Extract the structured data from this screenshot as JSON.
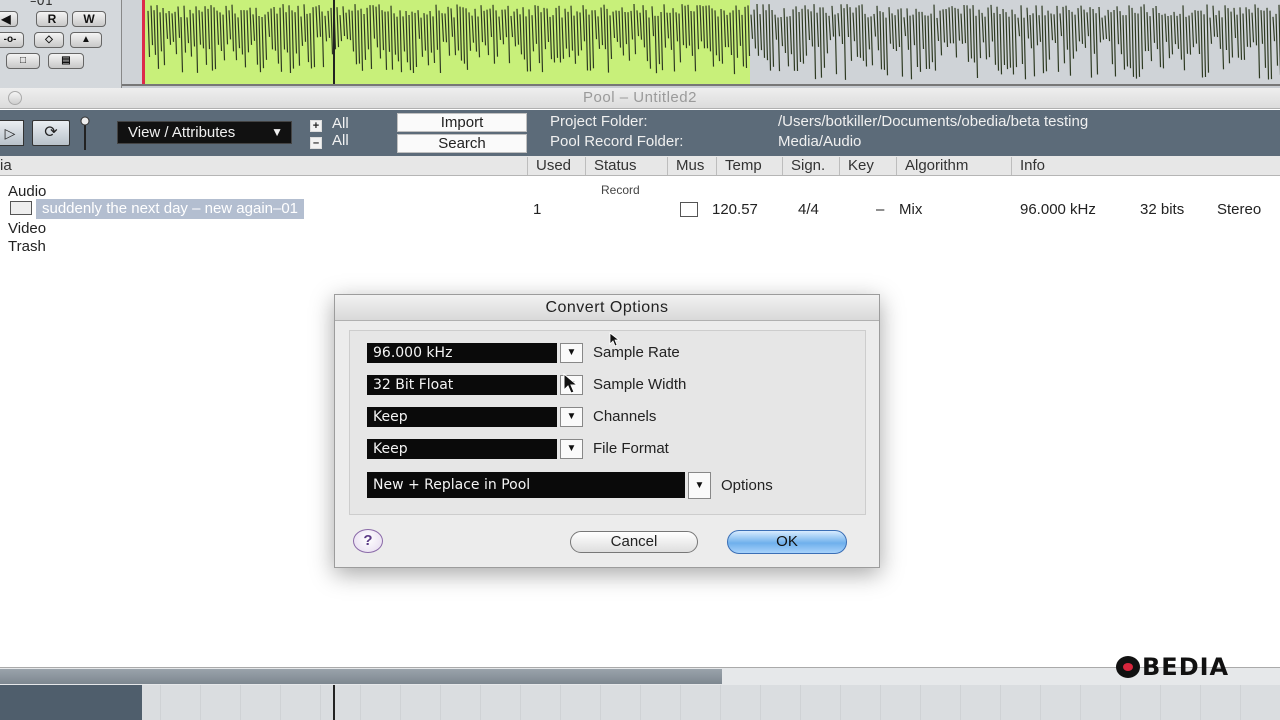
{
  "track": {
    "name_fragment": "–01",
    "buttons": {
      "read": "R",
      "write": "W"
    }
  },
  "pool_window": {
    "title": "Pool – Untitled2",
    "toolbar": {
      "view_attributes": "View / Attributes",
      "all_expand": "All",
      "all_collapse": "All",
      "import": "Import",
      "search": "Search",
      "project_folder_label": "Project Folder:",
      "project_folder_value": "/Users/botkiller/Documents/obedia/beta testing",
      "pool_record_folder_label": "Pool Record Folder:",
      "pool_record_folder_value": "Media/Audio"
    },
    "columns": {
      "media": "ia",
      "used": "Used",
      "status": "Status",
      "mus": "Mus",
      "temp": "Temp",
      "sign": "Sign.",
      "key": "Key",
      "algorithm": "Algorithm",
      "info": "Info"
    },
    "folders": {
      "audio": "Audio",
      "video": "Video",
      "trash": "Trash"
    },
    "record_label": "Record",
    "clip": {
      "name": "suddenly the next day – new again–01",
      "used": "1",
      "tempo": "120.57",
      "signature": "4/4",
      "key": "–",
      "algorithm": "Mix",
      "sample_rate": "96.000 kHz",
      "bits": "32 bits",
      "channels": "Stereo"
    }
  },
  "dialog": {
    "title": "Convert Options",
    "rows": [
      {
        "value": "96.000 kHz",
        "label": "Sample Rate"
      },
      {
        "value": "32 Bit Float",
        "label": "Sample Width"
      },
      {
        "value": "Keep",
        "label": "Channels"
      },
      {
        "value": "Keep",
        "label": "File Format"
      }
    ],
    "options": {
      "value": "New + Replace in Pool",
      "label": "Options"
    },
    "help": "?",
    "cancel": "Cancel",
    "ok": "OK"
  },
  "logo": {
    "text": "BEDIA"
  },
  "colors": {
    "toolbar_bg": "#5c6b79",
    "waveform": "#c8f07a",
    "selection": "#b3bed0",
    "ok_button": "#6fb0ec"
  },
  "icons": [
    "play-icon",
    "loop-icon",
    "help-icon",
    "dropdown-arrow-icon",
    "audio-clip-icon",
    "mouse-pointer-icon"
  ]
}
